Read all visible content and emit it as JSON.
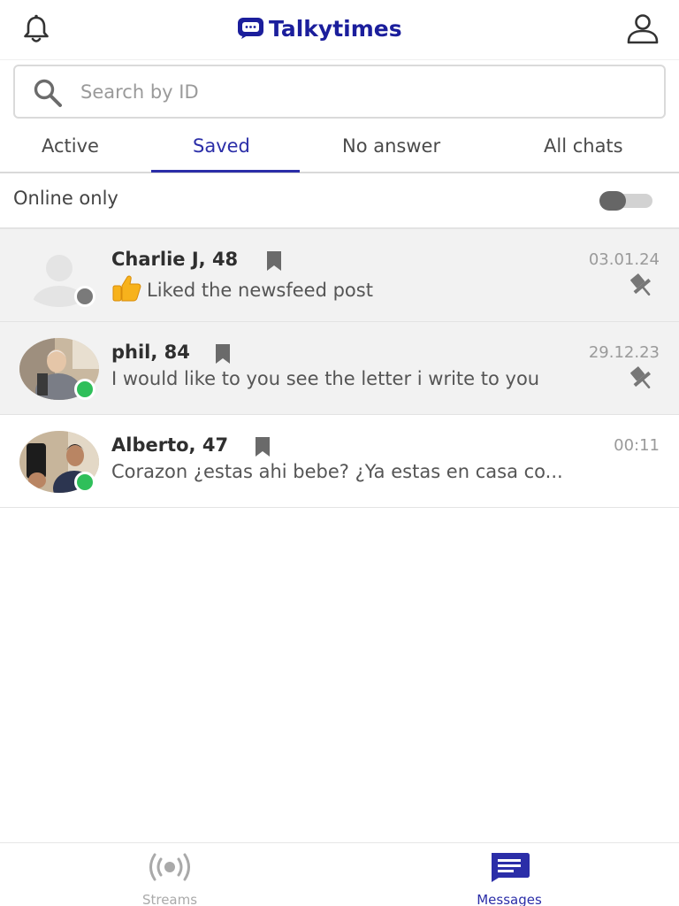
{
  "header": {
    "logo_text": "Talkytimes",
    "brand_color": "#1b1e9c",
    "left_icon": "bell-icon",
    "right_icon": "user-profile-icon"
  },
  "search": {
    "placeholder": "Search by ID",
    "value": ""
  },
  "tabs": [
    {
      "label": "Active",
      "active": false
    },
    {
      "label": "Saved",
      "active": true
    },
    {
      "label": "No answer",
      "active": false
    },
    {
      "label": "All chats",
      "active": false
    }
  ],
  "accent_color": "#2b2ea8",
  "filter": {
    "label": "Online only",
    "enabled": false
  },
  "chats": [
    {
      "name": "Charlie J, 48",
      "time": "03.01.24",
      "message": "Liked the newsfeed post",
      "online": false,
      "saved": true,
      "pinned": true,
      "avatar": "default-avatar",
      "message_icon": "thumbs-up-icon"
    },
    {
      "name": "phil, 84",
      "time": "29.12.23",
      "message": "I would like to you see the letter i write to you",
      "online": true,
      "saved": true,
      "pinned": true,
      "avatar": "photo"
    },
    {
      "name": "Alberto, 47",
      "time": "00:11",
      "message": "Corazon ¿estas ahi bebe? ¿Ya estas en casa co...",
      "online": true,
      "saved": true,
      "pinned": false,
      "avatar": "photo"
    }
  ],
  "status_colors": {
    "online": "#2fbf5a",
    "offline": "#7a7a7a"
  },
  "bottom_nav": [
    {
      "label": "Streams",
      "icon": "broadcast-icon",
      "active": false
    },
    {
      "label": "Messages",
      "icon": "message-icon",
      "active": true
    }
  ]
}
